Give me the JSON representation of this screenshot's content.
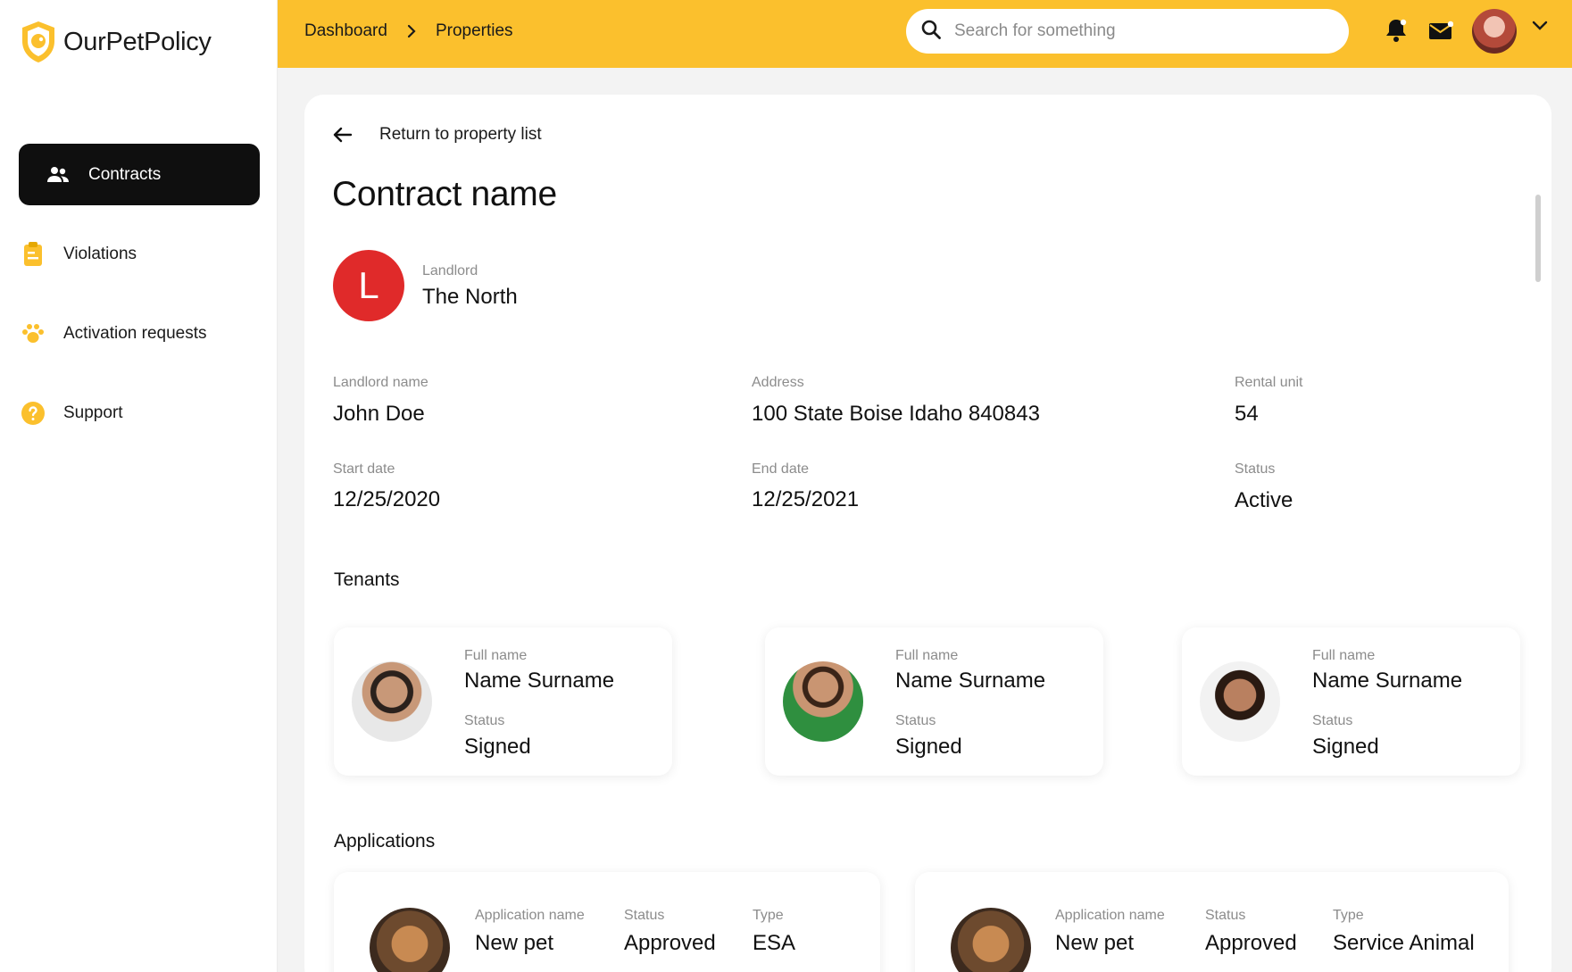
{
  "app": {
    "brand": "OurPetPolicy"
  },
  "colors": {
    "accent": "#fbc02d",
    "active_nav": "#0f0f0f",
    "landlord_badge": "#e02a2a"
  },
  "sidebar": {
    "items": [
      {
        "label": "Contracts",
        "icon": "people-icon",
        "active": true
      },
      {
        "label": "Violations",
        "icon": "clipboard-icon",
        "active": false
      },
      {
        "label": "Activation requests",
        "icon": "paw-icon",
        "active": false
      },
      {
        "label": "Support",
        "icon": "help-icon",
        "active": false
      }
    ]
  },
  "header": {
    "breadcrumb": [
      "Dashboard",
      "Properties"
    ],
    "search_placeholder": "Search for something",
    "icons": [
      "bell-icon",
      "mail-icon",
      "avatar",
      "chevron-down-icon"
    ]
  },
  "contract": {
    "back_label": "Return to property list",
    "title": "Contract name",
    "landlord_initial": "L",
    "landlord_label": "Landlord",
    "landlord_company": "The North",
    "fields": {
      "landlord_name": {
        "label": "Landlord name",
        "value": "John Doe"
      },
      "address": {
        "label": "Address",
        "value": "100 State Boise Idaho 840843"
      },
      "rental_unit": {
        "label": "Rental unit",
        "value": "54"
      },
      "start_date": {
        "label": "Start date",
        "value": "12/25/2020"
      },
      "end_date": {
        "label": "End date",
        "value": "12/25/2021"
      },
      "status": {
        "label": "Status",
        "value": "Active"
      }
    }
  },
  "tenants": {
    "title": "Tenants",
    "items": [
      {
        "name_label": "Full name",
        "name": "Name Surname",
        "status_label": "Status",
        "status": "Signed"
      },
      {
        "name_label": "Full name",
        "name": "Name Surname",
        "status_label": "Status",
        "status": "Signed"
      },
      {
        "name_label": "Full name",
        "name": "Name Surname",
        "status_label": "Status",
        "status": "Signed"
      }
    ]
  },
  "applications": {
    "title": "Applications",
    "items": [
      {
        "name_label": "Application name",
        "name": "New pet",
        "status_label": "Status",
        "status": "Approved",
        "type_label": "Type",
        "type": "ESA"
      },
      {
        "name_label": "Application name",
        "name": "New pet",
        "status_label": "Status",
        "status": "Approved",
        "type_label": "Type",
        "type": "Service Animal"
      }
    ]
  }
}
